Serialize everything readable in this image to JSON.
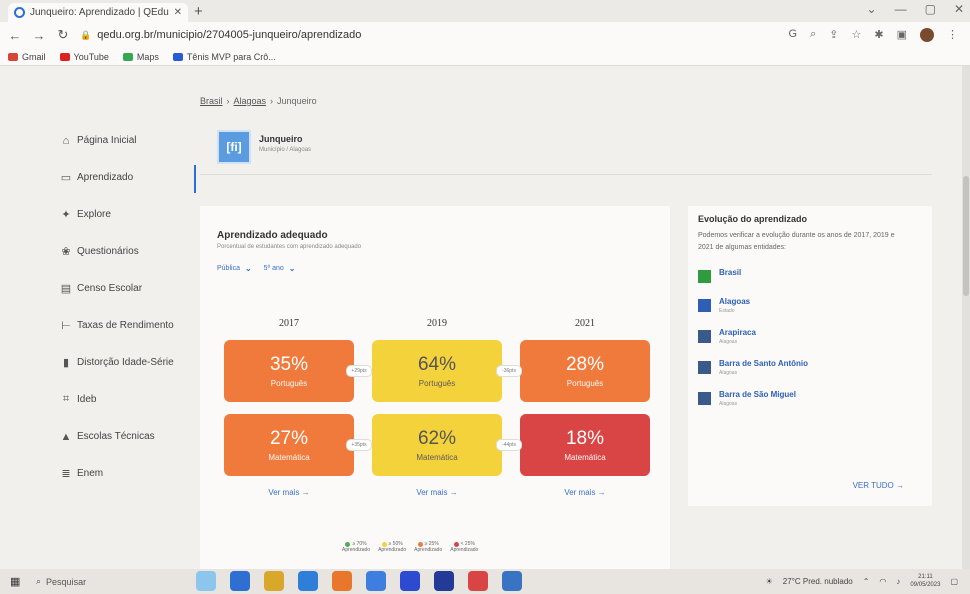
{
  "browser": {
    "tab_title": "Junqueiro: Aprendizado | QEdu",
    "tab_close": "✕",
    "new_tab": "+",
    "url": "qedu.org.br/municipio/2704005-junqueiro/aprendizado",
    "window_controls": [
      "⌄",
      "—",
      "▢",
      "✕"
    ],
    "bookmarks": [
      {
        "label": "Gmail",
        "color": "#d44638"
      },
      {
        "label": "YouTube",
        "color": "#e02020"
      },
      {
        "label": "Maps",
        "color": "#34a853"
      },
      {
        "label": "Tênis MVP para Crô...",
        "color": "#2a5bd7"
      }
    ]
  },
  "breadcrumb": {
    "items": [
      "Brasil",
      "Alagoas",
      "Junqueiro"
    ],
    "separator": "›"
  },
  "sidebar": {
    "items": [
      {
        "label": "Página Inicial",
        "icon": "home-icon",
        "glyph": "⌂"
      },
      {
        "label": "Aprendizado",
        "icon": "book-icon",
        "glyph": "▭",
        "active": true
      },
      {
        "label": "Explore",
        "icon": "explore-icon",
        "glyph": "✦"
      },
      {
        "label": "Questionários",
        "icon": "people-icon",
        "glyph": "❀"
      },
      {
        "label": "Censo Escolar",
        "icon": "school-icon",
        "glyph": "▤"
      },
      {
        "label": "Taxas de Rendimento",
        "icon": "rate-icon",
        "glyph": "⊢"
      },
      {
        "label": "Distorção Idade-Série",
        "icon": "distortion-icon",
        "glyph": "▮"
      },
      {
        "label": "Ideb",
        "icon": "chart-icon",
        "glyph": "⌗"
      },
      {
        "label": "Escolas Técnicas",
        "icon": "technical-school-icon",
        "glyph": "▲"
      },
      {
        "label": "Enem",
        "icon": "enem-icon",
        "glyph": "≣"
      }
    ]
  },
  "city": {
    "name": "Junqueiro",
    "sub": "Município / Alagoas",
    "flag_glyph": "[fi]"
  },
  "learning": {
    "title": "Aprendizado adequado",
    "subtitle": "Porcentual de estudantes com aprendizado adequado",
    "filters": [
      {
        "label": "Pública",
        "chevron": "⌄"
      },
      {
        "label": "5º ano",
        "chevron": "⌄"
      }
    ],
    "years": [
      {
        "year": "2017",
        "portugues": "35%",
        "matematica": "27%",
        "portugues_color": "orange",
        "matematica_color": "orange",
        "ver_mais": "Ver mais →"
      },
      {
        "year": "2019",
        "portugues": "64%",
        "matematica": "62%",
        "portugues_color": "yellow",
        "matematica_color": "yellow",
        "ver_mais": "Ver mais →"
      },
      {
        "year": "2021",
        "portugues": "28%",
        "matematica": "18%",
        "portugues_color": "orange",
        "matematica_color": "red",
        "ver_mais": "Ver mais →"
      }
    ],
    "subject_labels": {
      "portugues": "Português",
      "matematica": "Matemática"
    },
    "diffs": {
      "p_2017_2019": "+29pts",
      "p_2019_2021": "-36pts",
      "m_2017_2019": "+35pts",
      "m_2019_2021": "-44pts"
    },
    "legend": [
      {
        "top": "≥ 70%",
        "bottom": "Aprendizado",
        "color": "#4caf50"
      },
      {
        "top": "≥ 50%",
        "bottom": "Aprendizado",
        "color": "#f4d23c"
      },
      {
        "top": "≥ 25%",
        "bottom": "Aprendizado",
        "color": "#f07a3c"
      },
      {
        "top": "< 25%",
        "bottom": "Aprendizado",
        "color": "#d94545"
      }
    ]
  },
  "evolution": {
    "title": "Evolução do aprendizado",
    "desc": "Podemos verificar a evolução durante os anos de 2017, 2019 e 2021 de algumas entidades:",
    "entities": [
      {
        "name": "Brasil",
        "sub": "",
        "color": "#2e9b3e"
      },
      {
        "name": "Alagoas",
        "sub": "Estado",
        "color": "#2e5fb5"
      },
      {
        "name": "Arapiraca",
        "sub": "Alagoas",
        "color": "#3a5a8c"
      },
      {
        "name": "Barra de Santo Antônio",
        "sub": "Alagoas",
        "color": "#3a5a8c"
      },
      {
        "name": "Barra de São Miguel",
        "sub": "Alagoas",
        "color": "#3a5a8c"
      }
    ],
    "ver_tudo": "VER TUDO →"
  },
  "taskbar": {
    "search": "Pesquisar",
    "weather": "27°C  Pred. nublado",
    "time": "21:11",
    "date": "09/05/2023"
  },
  "colors": {
    "orange": "#f07a3c",
    "yellow": "#f4d23c",
    "red": "#d94545",
    "accent": "#2e6dd8"
  }
}
